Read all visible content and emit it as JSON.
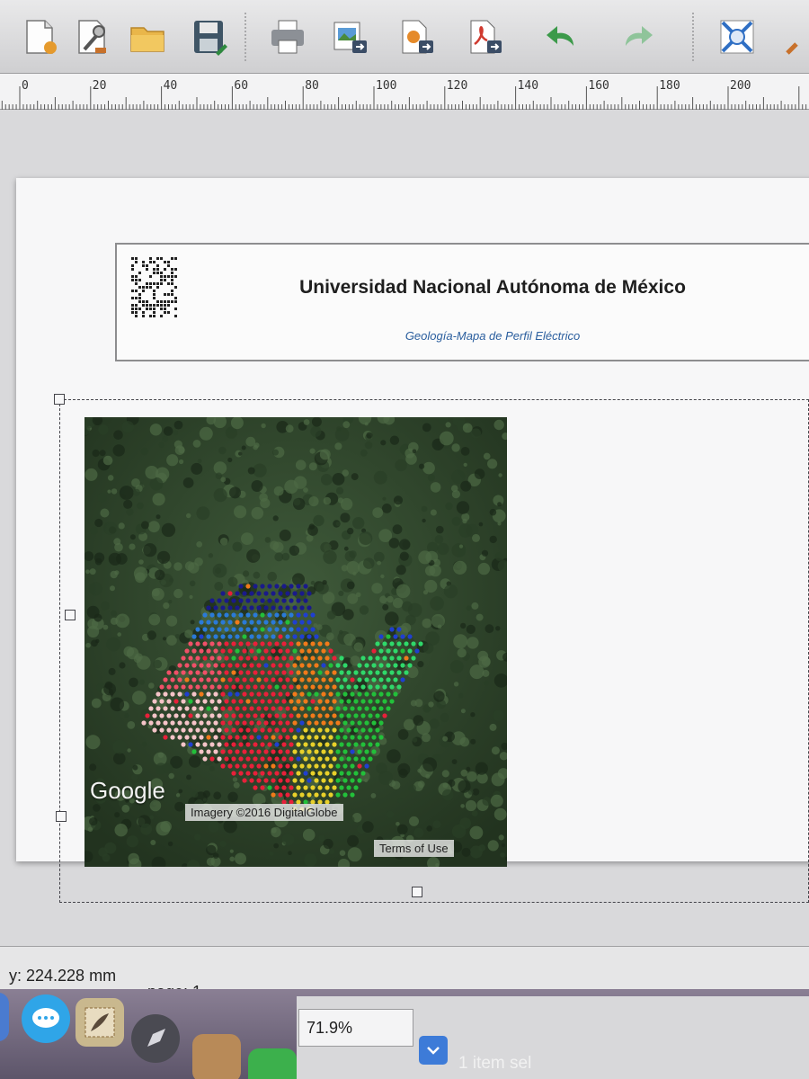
{
  "toolbar": {
    "buttons": [
      {
        "name": "new-composer",
        "icon": "new-document-icon"
      },
      {
        "name": "composer-manager",
        "icon": "wrench-document-icon"
      },
      {
        "name": "open-template",
        "icon": "folder-icon"
      },
      {
        "name": "save-template",
        "icon": "floppy-disk-icon"
      },
      {
        "name": "print",
        "icon": "printer-icon"
      },
      {
        "name": "export-image",
        "icon": "export-image-icon"
      },
      {
        "name": "export-svg",
        "icon": "export-svg-icon"
      },
      {
        "name": "export-pdf",
        "icon": "export-pdf-icon"
      },
      {
        "name": "undo",
        "icon": "undo-icon"
      },
      {
        "name": "redo",
        "icon": "redo-icon"
      },
      {
        "name": "zoom-full",
        "icon": "zoom-full-icon"
      },
      {
        "name": "zoom-in",
        "icon": "zoom-in-icon"
      }
    ]
  },
  "ruler": {
    "ticks": [
      "0",
      "20",
      "40",
      "60",
      "80",
      "100",
      "120",
      "140",
      "160",
      "180",
      "200"
    ]
  },
  "layout": {
    "header": {
      "title": "Universidad Nacional Autónoma de México",
      "subtitle": "Geología-Mapa de Perfil Eléctrico"
    },
    "map": {
      "attribution_logo": "Google",
      "imagery_credit": "Imagery ©2016 DigitalGlobe",
      "terms": "Terms of Use"
    }
  },
  "status": {
    "coordinate": "y: 224.228 mm",
    "page": "page: 1"
  },
  "bottom": {
    "zoom": "71.9%",
    "selection": "1 item sel"
  },
  "colors": {
    "subtitle": "#2a5e9e",
    "title": "#1f1f1f",
    "toolbar_bg": "#dcdcde",
    "page_bg": "#f7f7f8"
  }
}
